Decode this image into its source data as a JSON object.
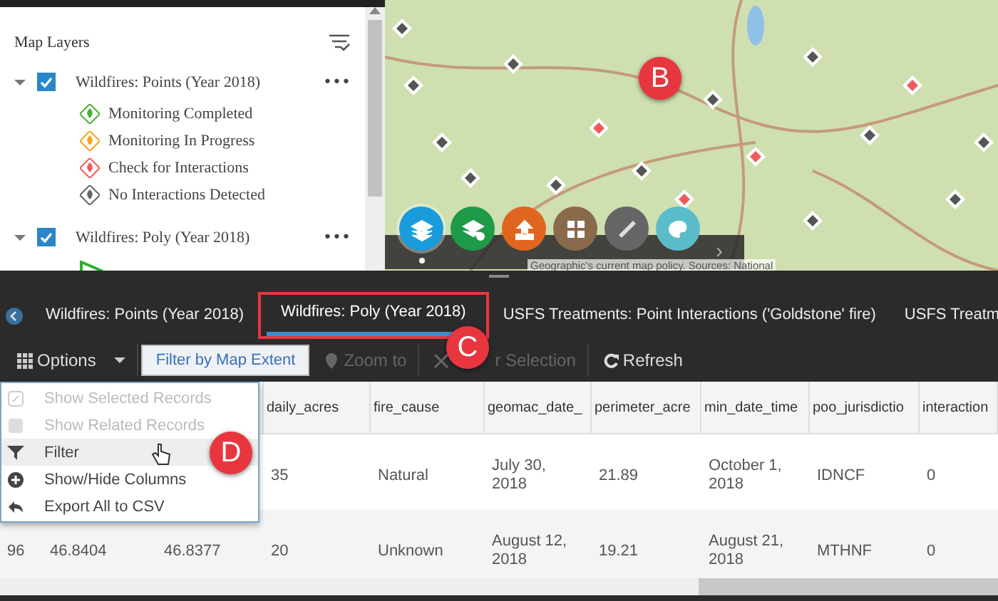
{
  "layer_list": {
    "heading": "Map Layers",
    "layers": [
      {
        "title": "Wildfires: Points (Year 2018)",
        "checked": true,
        "expanded": true,
        "more": "•••",
        "legend": [
          {
            "label": "Monitoring Completed",
            "color": "#4caf37",
            "kind": "point"
          },
          {
            "label": "Monitoring In Progress",
            "color": "#f7a21b",
            "kind": "point"
          },
          {
            "label": "Check for Interactions",
            "color": "#f25a5a",
            "kind": "point"
          },
          {
            "label": "No Interactions Detected",
            "color": "#666666",
            "kind": "point"
          }
        ]
      },
      {
        "title": "Wildfires: Poly (Year 2018)",
        "checked": true,
        "expanded": true,
        "more": "•••",
        "legend": [
          {
            "color": "#2fae2f",
            "kind": "polygon"
          }
        ]
      }
    ]
  },
  "map": {
    "callout": "B",
    "attribution": "Geographic's current map policy. Sources: National",
    "tools": [
      {
        "color": "#1a9bdc",
        "selected": true
      },
      {
        "color": "#1e9a48",
        "selected": false
      },
      {
        "color": "#e0661f",
        "selected": false
      },
      {
        "color": "#8a6a4c",
        "selected": false
      },
      {
        "color": "#666666",
        "selected": false
      },
      {
        "color": "#5bbcc9",
        "selected": false
      }
    ],
    "next": "›"
  },
  "tabs": [
    {
      "label": "Wildfires: Points (Year 2018)",
      "selected": false,
      "highlighted": false
    },
    {
      "label": "Wildfires: Poly (Year 2018)",
      "selected": true,
      "highlighted": true,
      "callout": "C"
    },
    {
      "label": "USFS Treatments: Point Interactions ('Goldstone' fire)",
      "selected": false,
      "highlighted": false
    },
    {
      "label": "USFS Treatm",
      "selected": false,
      "highlighted": false
    }
  ],
  "toolbar": [
    {
      "kind": "menu",
      "label": "Options",
      "disabled": false
    },
    {
      "kind": "toggle",
      "label": "Filter by Map Extent",
      "disabled": false
    },
    {
      "kind": "button",
      "label": "Zoom to",
      "disabled": true
    },
    {
      "kind": "button",
      "label": "r Selection",
      "disabled": true
    },
    {
      "kind": "button",
      "label": "Refresh",
      "disabled": false
    }
  ],
  "options_menu": [
    {
      "label": "Show Selected Records",
      "disabled": true,
      "hovered": false
    },
    {
      "label": "Show Related Records",
      "disabled": true,
      "hovered": false
    },
    {
      "label": "Filter",
      "disabled": false,
      "hovered": true,
      "callout": "D"
    },
    {
      "label": "Show/Hide Columns",
      "disabled": false,
      "hovered": false
    },
    {
      "label": "Export All to CSV",
      "disabled": false,
      "hovered": false
    }
  ],
  "table": {
    "columns": [
      null,
      null,
      null,
      "daily_acres",
      "fire_cause",
      "geomac_date_",
      "perimeter_acre",
      "min_date_time",
      "poo_jurisdictio",
      "interaction"
    ],
    "rows": [
      [
        null,
        null,
        null,
        "35",
        "Natural",
        "July 30, 2018",
        "21.89",
        "October 1, 2018",
        "IDNCF",
        "0"
      ],
      [
        "96",
        "46.8404",
        "46.8377",
        "20",
        "Unknown",
        "August 12, 2018",
        "19.21",
        "August 21, 2018",
        "MTHNF",
        "0"
      ]
    ]
  }
}
